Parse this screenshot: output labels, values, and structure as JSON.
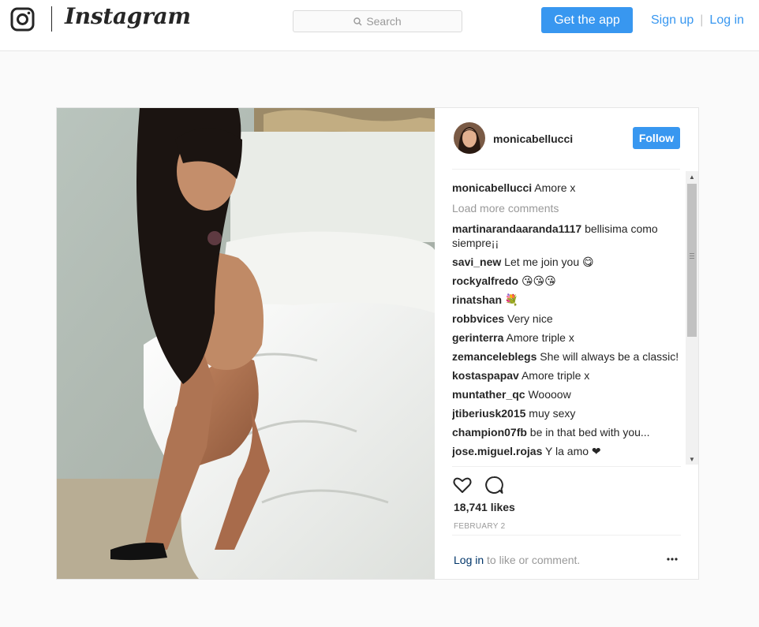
{
  "header": {
    "wordmark": "Instagram",
    "search_placeholder": "Search",
    "get_app_label": "Get the app",
    "signup_label": "Sign up",
    "divider": "|",
    "login_label": "Log in"
  },
  "post": {
    "username": "monicabellucci",
    "follow_label": "Follow",
    "caption_user": "monicabellucci",
    "caption_text": "Amore x",
    "load_more": "Load more comments",
    "comments": [
      {
        "user": "martinarandaaranda1117",
        "text": "bellisima como siempre¡¡"
      },
      {
        "user": "savi_new",
        "text": "Let me join you 😋"
      },
      {
        "user": "rockyalfredo",
        "text": "😘😘😘"
      },
      {
        "user": "rinatshan",
        "text": "💐"
      },
      {
        "user": "robbvices",
        "text": "Very nice"
      },
      {
        "user": "gerinterra",
        "text": "Amore triple x"
      },
      {
        "user": "zemanceleblegs",
        "text": "She will always be a classic!"
      },
      {
        "user": "kostaspapav",
        "text": "Amore triple x"
      },
      {
        "user": "muntather_qc",
        "text": "Woooow"
      },
      {
        "user": "jtiberiusk2015",
        "text": "muy sexy"
      },
      {
        "user": "champion07fb",
        "text": "be in that bed with you..."
      },
      {
        "user": "jose.miguel.rojas",
        "text": "Y la amo ❤"
      }
    ],
    "likes": "18,741 likes",
    "date": "FEBRUARY 2",
    "login_link": "Log in",
    "login_rest": " to like or comment."
  },
  "colors": {
    "accent": "#3897f0",
    "background": "#fafafa",
    "text": "#262626",
    "muted": "#999999"
  },
  "icons": [
    "instagram-camera-icon",
    "search-icon",
    "heart-icon",
    "comment-icon",
    "more-options-icon"
  ]
}
